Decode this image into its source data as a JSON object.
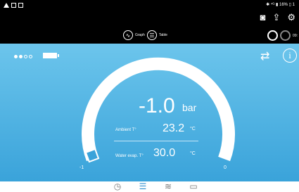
{
  "status_bar": {
    "right_text": "✱ ⁴ᴳ ▮ 16% ▯ 1"
  },
  "toolbar": {
    "icons": [
      "camera-icon",
      "share-icon",
      "settings-icon"
    ]
  },
  "nav": {
    "graph_label": "Graph",
    "table_label": "Table",
    "right_text": "09:"
  },
  "indicators": {
    "page_dots": 4,
    "active_dots": 2
  },
  "gauge": {
    "main_value": "-1.0",
    "main_unit": "bar",
    "min_label": "-1",
    "max_label": "0",
    "fill_fraction": 0.0
  },
  "readings": {
    "ambient_label": "Ambient T°",
    "ambient_value": "23.2",
    "ambient_unit": "°C",
    "water_label": "Water evap. T°",
    "water_value": "30.0",
    "water_unit": "°C"
  },
  "bottom_nav": {
    "items": [
      "gauge-icon",
      "evaporator-icon",
      "fan-icon",
      "container-icon"
    ],
    "active_index": 1
  },
  "colors": {
    "background_top": "#6cc5ec",
    "background_bottom": "#3aa3da",
    "accent": "#2f8fd0"
  }
}
